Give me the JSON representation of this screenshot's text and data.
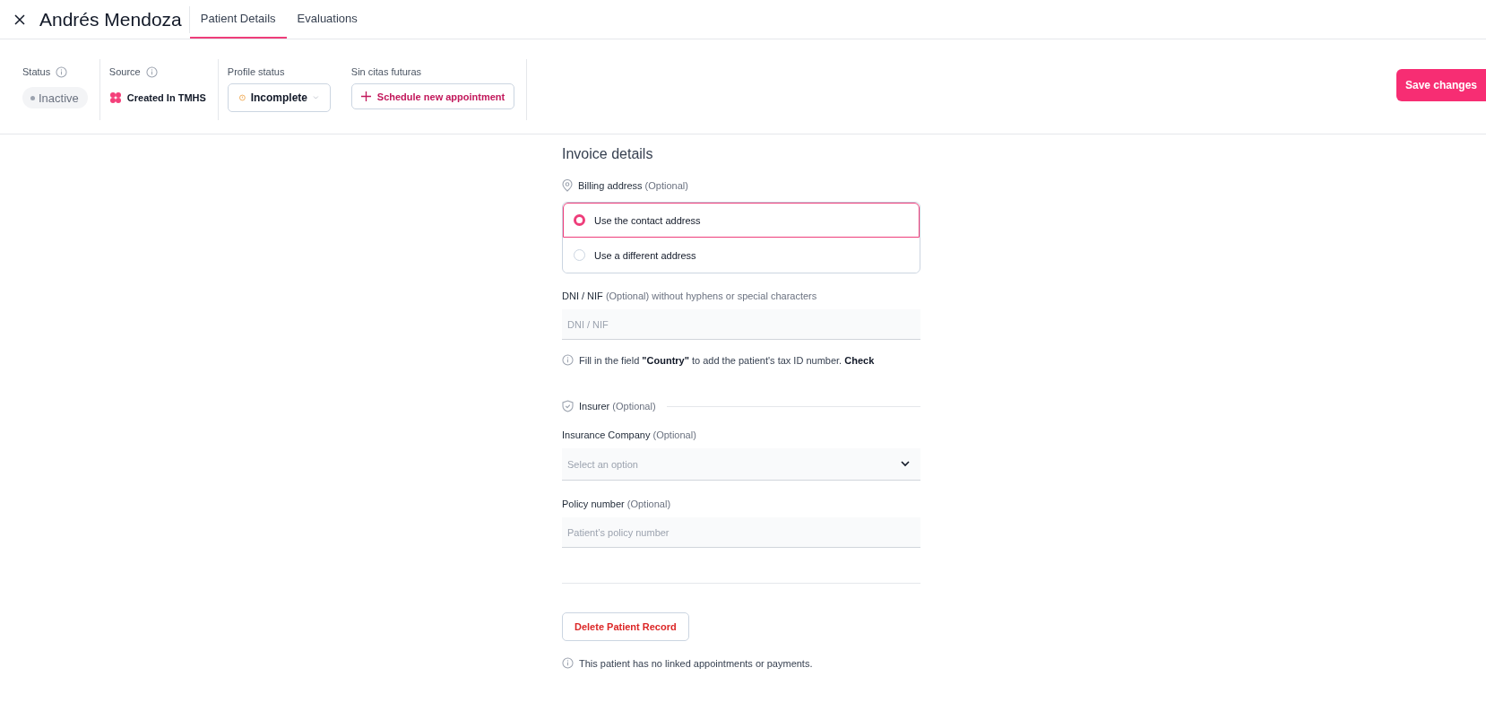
{
  "header": {
    "title": "Andrés Mendoza",
    "tabs": [
      {
        "label": "Patient Details",
        "selected": true
      },
      {
        "label": "Evaluations",
        "selected": false
      }
    ]
  },
  "info_bar": {
    "status": {
      "label": "Status",
      "value": "Inactive"
    },
    "source": {
      "label": "Source",
      "value": "Created In TMHS"
    },
    "profile_status": {
      "label": "Profile status",
      "value": "Incomplete"
    },
    "appointments": {
      "label": "Sin citas futuras",
      "button": "Schedule new appointment"
    },
    "save_button": "Save changes"
  },
  "invoice": {
    "title": "Invoice details",
    "billing": {
      "label": "Billing address",
      "optional": "(Optional)",
      "options": [
        {
          "label": "Use the contact address",
          "selected": true
        },
        {
          "label": "Use a different address",
          "selected": false
        }
      ]
    },
    "tax_id": {
      "label": "DNI / NIF",
      "optional": "(Optional) without hyphens or special characters",
      "placeholder": "DNI / NIF",
      "hint": "Fill in the field **\"Country\"** to add the patient's tax ID number. **Check**"
    },
    "insurer": {
      "label": "Insurer",
      "optional": "(Optional)"
    },
    "insurance_company": {
      "label": "Insurance Company",
      "optional": " (Optional)",
      "placeholder": "Select an option"
    },
    "policy_number": {
      "label": "Policy number",
      "optional": "(Optional)",
      "placeholder": "Patient’s policy number"
    }
  },
  "delete_button": "Delete Patient Record",
  "note": "This patient has no linked appointments or payments."
}
